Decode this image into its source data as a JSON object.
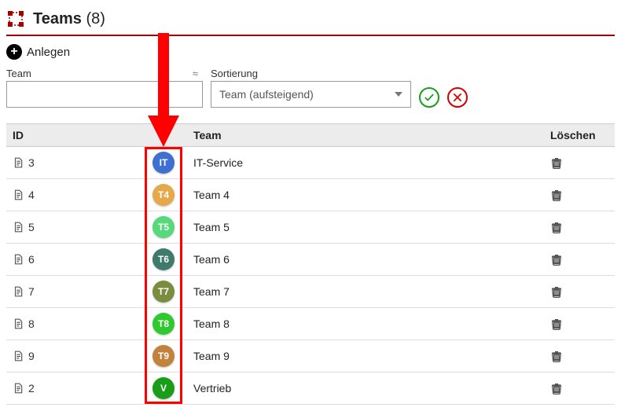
{
  "header": {
    "title": "Teams",
    "count_display": "(8)"
  },
  "toolbar": {
    "create_label": "Anlegen"
  },
  "filter": {
    "team_label": "Team",
    "team_value": "",
    "approx_symbol": "≈",
    "sort_label": "Sortierung",
    "sort_selected": "Team (aufsteigend)"
  },
  "columns": {
    "id": "ID",
    "team": "Team",
    "delete": "Löschen"
  },
  "rows": [
    {
      "id": "3",
      "badge": "IT",
      "badge_color": "#3f6fd1",
      "team": "IT-Service"
    },
    {
      "id": "4",
      "badge": "T4",
      "badge_color": "#e5a94a",
      "team": "Team 4"
    },
    {
      "id": "5",
      "badge": "T5",
      "badge_color": "#55d97a",
      "team": "Team 5"
    },
    {
      "id": "6",
      "badge": "T6",
      "badge_color": "#3f7a6c",
      "team": "Team 6"
    },
    {
      "id": "7",
      "badge": "T7",
      "badge_color": "#7a8c3d",
      "team": "Team 7"
    },
    {
      "id": "8",
      "badge": "T8",
      "badge_color": "#2fc92f",
      "team": "Team 8"
    },
    {
      "id": "9",
      "badge": "T9",
      "badge_color": "#c2823e",
      "team": "Team 9"
    },
    {
      "id": "2",
      "badge": "V",
      "badge_color": "#1a9e1a",
      "team": "Vertrieb"
    }
  ]
}
